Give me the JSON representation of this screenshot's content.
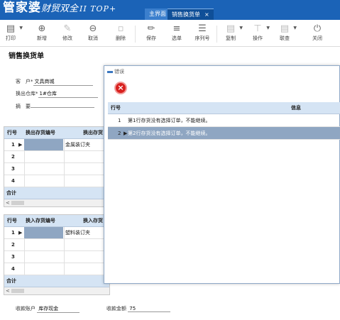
{
  "app": {
    "logo_main": "管家婆",
    "logo_sub": "财贸双全",
    "logo_ver": "II TOP+",
    "tabs": [
      {
        "label": "主界面"
      },
      {
        "label": "销售换货单",
        "close": "×"
      }
    ]
  },
  "toolbar": {
    "items": [
      {
        "label": "打印",
        "icon": "printer-icon"
      },
      {
        "label": "新增",
        "icon": "plus-circle-icon"
      },
      {
        "label": "修改",
        "icon": "edit-icon"
      },
      {
        "label": "取消",
        "icon": "minus-circle-icon"
      },
      {
        "label": "删除",
        "icon": "trash-icon"
      },
      {
        "label": "保存",
        "icon": "brush-icon"
      },
      {
        "label": "选单",
        "icon": "list-select-icon"
      },
      {
        "label": "序列号",
        "icon": "list-icon"
      },
      {
        "label": "复制",
        "icon": "copy-icon"
      },
      {
        "label": "操作",
        "icon": "tool-icon"
      },
      {
        "label": "联查",
        "icon": "link-icon"
      },
      {
        "label": "关闭",
        "icon": "power-icon"
      }
    ]
  },
  "form": {
    "title": "销售换货单",
    "customer_label": "客　户*",
    "customer_value": "文具商城",
    "warehouse_label": "换出仓库*",
    "warehouse_value": "1#仓库",
    "summary_label": "摘　要",
    "summary_value": ""
  },
  "grid_out": {
    "col_row": "行号",
    "col_code": "换出存货编号",
    "col_name": "换出存货",
    "rows": [
      {
        "num": "1",
        "name": "金属装订夹"
      },
      {
        "num": "2",
        "name": ""
      },
      {
        "num": "3",
        "name": ""
      },
      {
        "num": "4",
        "name": ""
      }
    ],
    "total_label": "合计",
    "scroll_left": "<"
  },
  "grid_in": {
    "col_row": "行号",
    "col_code": "换入存货编号",
    "col_name": "换入存货",
    "rows": [
      {
        "num": "1",
        "name": "塑料装订夹"
      },
      {
        "num": "2",
        "name": ""
      },
      {
        "num": "3",
        "name": ""
      },
      {
        "num": "4",
        "name": ""
      }
    ],
    "total_label": "合计",
    "scroll_left": "<"
  },
  "footer": {
    "account_label": "收款账户",
    "account_value": "库存现金",
    "amount_label": "收款金额",
    "amount_value": "75"
  },
  "dialog": {
    "title": "错误",
    "col_row": "行号",
    "col_info": "信息",
    "rows": [
      {
        "num": "1",
        "message": "第1行存货没有选择订单，不能继续。"
      },
      {
        "num": "2",
        "message": "第2行存货没有选择订单，不能继续。",
        "selected": true
      }
    ]
  }
}
